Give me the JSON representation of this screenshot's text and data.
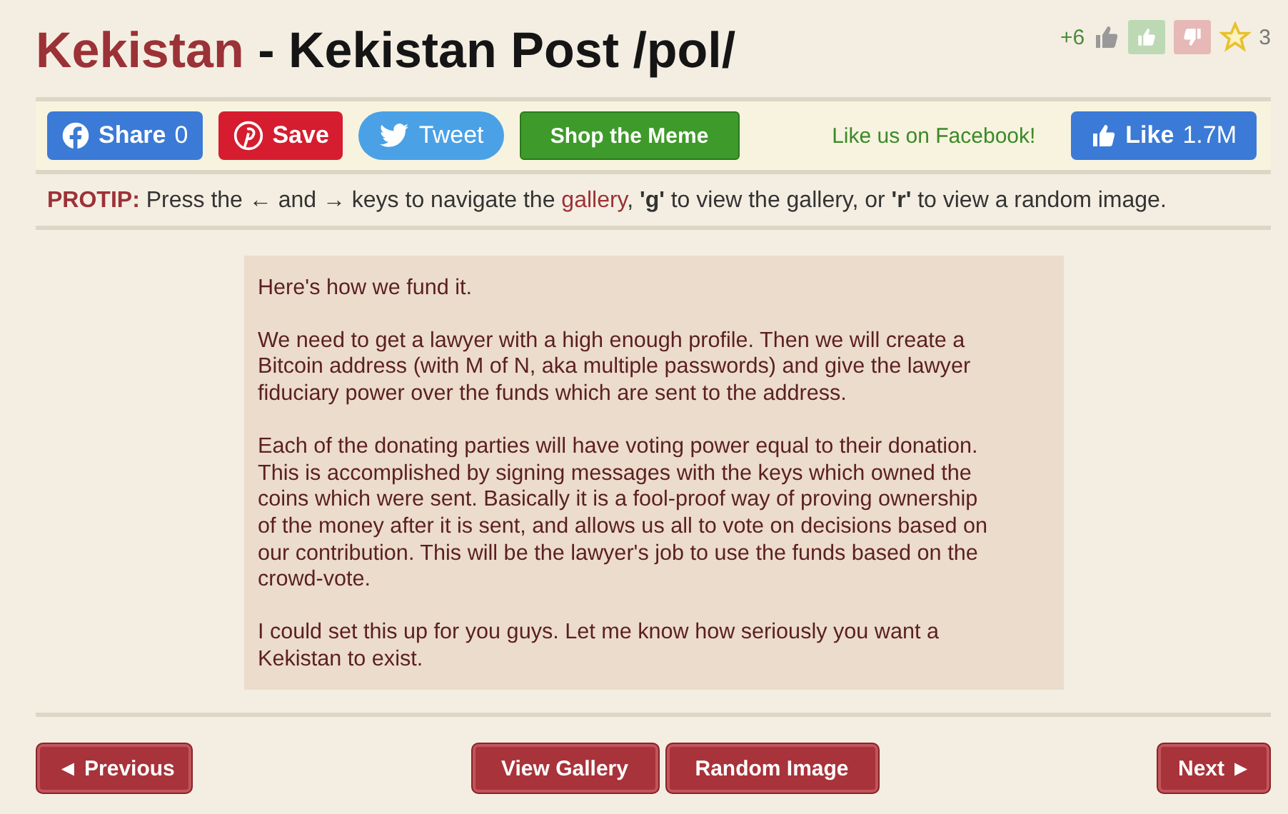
{
  "title": {
    "site": "Kekistan",
    "separator": " - ",
    "page": "Kekistan Post /pol/"
  },
  "rating": {
    "score": "+6",
    "favorite_count": "3"
  },
  "share_buttons": [
    {
      "kind": "facebook",
      "label": "Share",
      "count": "0"
    },
    {
      "kind": "pinterest",
      "label": "Save"
    },
    {
      "kind": "twitter",
      "label": "Tweet"
    },
    {
      "kind": "shop",
      "label": "Shop the Meme"
    }
  ],
  "facebook_like": {
    "prompt": "Like us on Facebook!",
    "label": "Like",
    "count": "1.7M"
  },
  "protip": {
    "label": "PROTIP:",
    "before": "Press the ← and → keys to navigate the",
    "link": "gallery",
    "after": ", **'g'** to view the gallery, or **'r'** to view a random image."
  },
  "post": {
    "paragraphs": [
      [
        "Here's how we fund it."
      ],
      [
        "We need to get a lawyer with a high enough profile. Then we will create a",
        "Bitcoin address (with M of N, aka multiple passwords) and give the lawyer",
        "fiduciary power over the funds which are sent to the address."
      ],
      [
        "Each of the donating parties will have voting power equal to their donation.",
        "This is accomplished by signing messages with the keys which owned the",
        "coins which were sent. Basically it is a fool-proof way of proving ownership",
        "of the money after it is sent, and allows us all to vote on decisions based on",
        "our contribution. This will be the lawyer's job to use the funds based on the",
        "crowd-vote."
      ],
      [
        "I could set this up for you guys. Let me know how seriously you want a",
        "Kekistan to exist."
      ]
    ]
  },
  "navigation": [
    {
      "kind": "previous",
      "label": "◄ Previous"
    },
    {
      "kind": "gallery",
      "label": "View Gallery"
    },
    {
      "kind": "random",
      "label": "Random Image"
    },
    {
      "kind": "next",
      "label": "Next ►"
    }
  ]
}
